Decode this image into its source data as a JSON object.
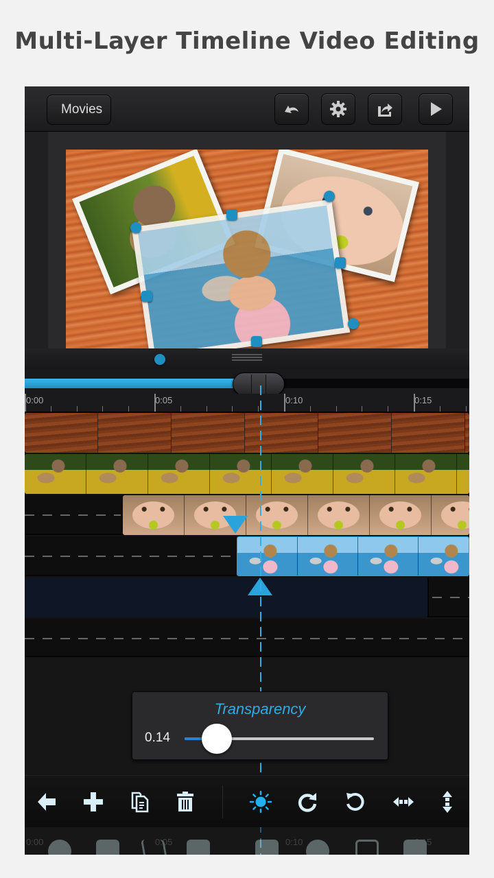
{
  "headline": "Multi-Layer Timeline Video Editing",
  "topbar": {
    "back_label": "Movies",
    "buttons": [
      {
        "name": "undo",
        "icon": "undo-icon"
      },
      {
        "name": "settings",
        "icon": "gear-icon"
      },
      {
        "name": "share",
        "icon": "share-icon"
      },
      {
        "name": "play",
        "icon": "play-icon"
      }
    ]
  },
  "preview": {
    "layers": [
      "wood-background",
      "teddy-photo",
      "girl-eating-photo",
      "girl-seashell-photo (selected)"
    ]
  },
  "scrubber": {
    "progress": 0.53
  },
  "ruler": {
    "labels": [
      "0:00",
      "0:05",
      "0:10",
      "0:15"
    ],
    "playhead_time": "0:08.7"
  },
  "tracks": [
    {
      "name": "wood background",
      "start": 0
    },
    {
      "name": "teddy clip",
      "start": 0
    },
    {
      "name": "girl eating clip",
      "start": 3.8
    },
    {
      "name": "girl seashell clip",
      "start": 8.2,
      "selected": true
    },
    {
      "name": "empty layer",
      "end": 15.8
    },
    {
      "name": "empty track"
    }
  ],
  "transparency_panel": {
    "title": "Transparency",
    "value": "0.14",
    "fraction": 0.14
  },
  "toolbar": {
    "tools": [
      {
        "name": "back",
        "icon": "arrow-left-icon"
      },
      {
        "name": "add",
        "icon": "plus-icon"
      },
      {
        "name": "duplicate",
        "icon": "copy-icon"
      },
      {
        "name": "delete",
        "icon": "trash-icon"
      },
      {
        "name": "brightness",
        "icon": "sun-icon",
        "active": true
      },
      {
        "name": "rotate-clockwise",
        "icon": "rotate-cw-icon"
      },
      {
        "name": "rotate-counterclockwise",
        "icon": "rotate-ccw-icon"
      },
      {
        "name": "flip-horizontal",
        "icon": "flip-horizontal-icon"
      },
      {
        "name": "flip-vertical",
        "icon": "flip-vertical-icon"
      }
    ]
  },
  "ghost_ruler": {
    "labels": [
      "0:00",
      "0:05",
      "0:10",
      "0:15"
    ]
  },
  "colors": {
    "accent": "#2aa3dc",
    "slider_fill": "#2a82d8",
    "background": "#141414"
  }
}
